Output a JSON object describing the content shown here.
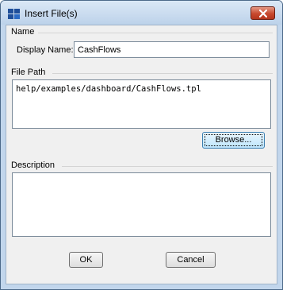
{
  "window": {
    "title": "Insert File(s)",
    "icon": "dashboard-icon",
    "accent": "#c2d6ec"
  },
  "name_section": {
    "title": "Name",
    "display_name_label": "Display Name:",
    "display_name_value": "CashFlows"
  },
  "file_path_section": {
    "title": "File Path",
    "path_value": "help/examples/dashboard/CashFlows.tpl",
    "browse_label": "Browse..."
  },
  "description_section": {
    "title": "Description",
    "value": ""
  },
  "footer": {
    "ok_label": "OK",
    "cancel_label": "Cancel"
  }
}
